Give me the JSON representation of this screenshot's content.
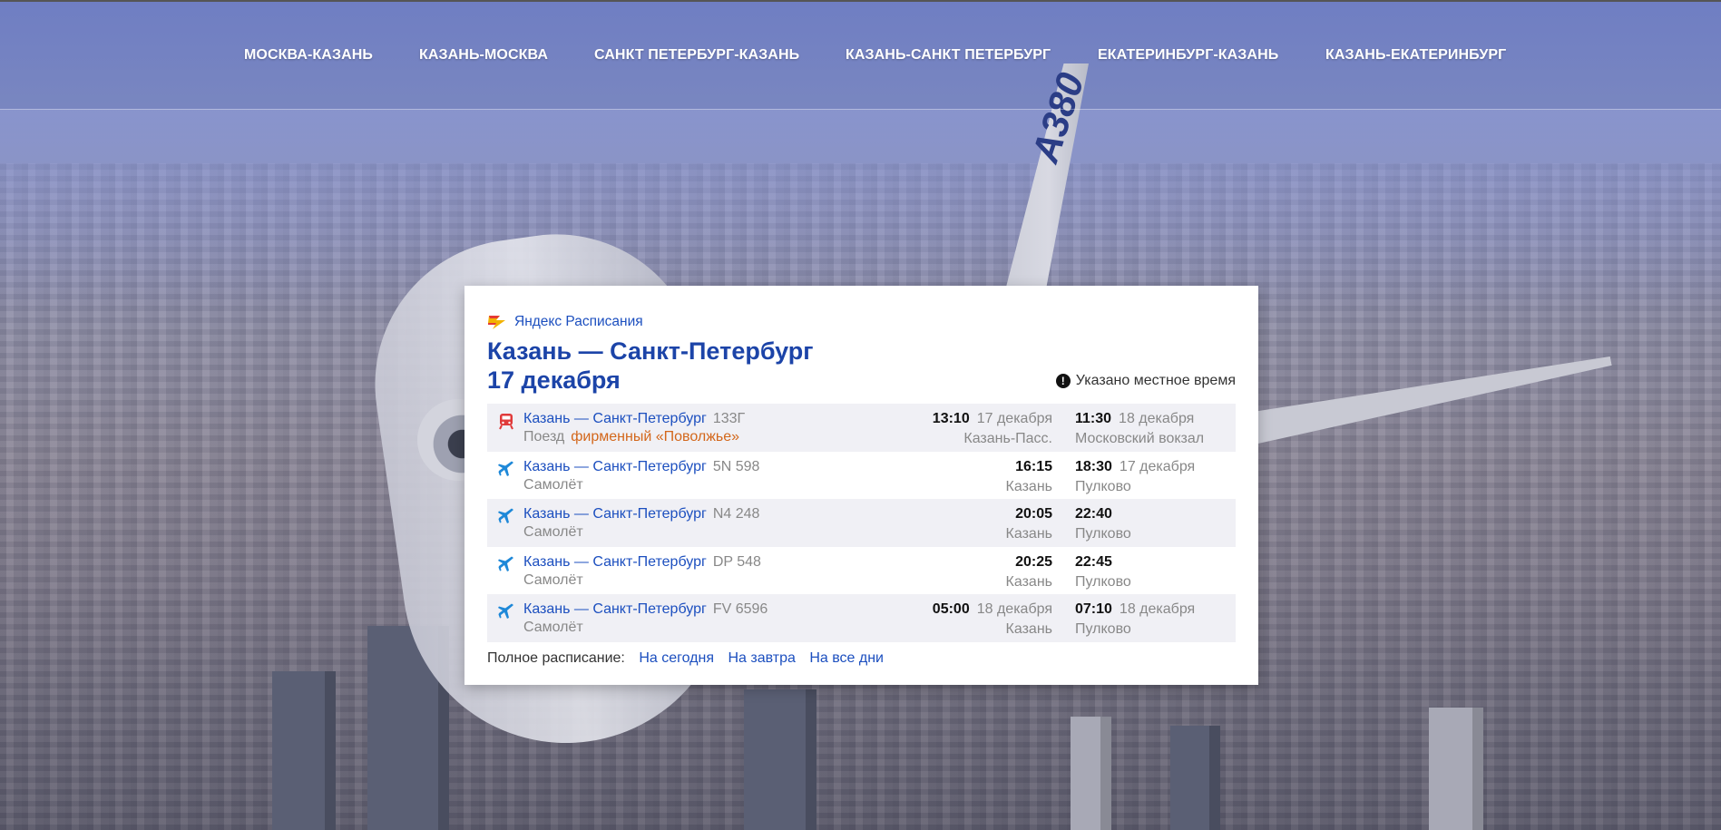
{
  "nav": {
    "links": [
      "МОСКВА-КАЗАНЬ",
      "КАЗАНЬ-МОСКВА",
      "САНКТ ПЕТЕРБУРГ-КАЗАНЬ",
      "КАЗАНЬ-САНКТ ПЕТЕРБУРГ",
      "ЕКАТЕРИНБУРГ-КАЗАНЬ",
      "КАЗАНЬ-ЕКАТЕРИНБУРГ"
    ]
  },
  "background": {
    "fin_text": "A380"
  },
  "widget": {
    "brand": "Яндекс Расписания",
    "title": "Казань — Санкт-Петербург",
    "date": "17 декабря",
    "note": "Указано местное время",
    "rows": [
      {
        "icon": "train-icon",
        "route": "Казань  — Санкт-Петербург",
        "number": "133Г",
        "kind": "Поезд",
        "brand_name": "фирменный «Поволжье»",
        "dep_time": "13:10",
        "dep_date": "17 декабря",
        "dep_station": "Казань-Пасс.",
        "arr_time": "11:30",
        "arr_date": "18 декабря",
        "arr_station": "Московский вокзал"
      },
      {
        "icon": "plane-icon",
        "route": "Казань  — Санкт-Петербург",
        "number": "5N 598",
        "kind": "Самолёт",
        "dep_time": "16:15",
        "dep_date": "",
        "dep_station": "Казань",
        "arr_time": "18:30",
        "arr_date": "17 декабря",
        "arr_station": "Пулково"
      },
      {
        "icon": "plane-icon",
        "route": "Казань  — Санкт-Петербург",
        "number": "N4 248",
        "kind": "Самолёт",
        "dep_time": "20:05",
        "dep_date": "",
        "dep_station": "Казань",
        "arr_time": "22:40",
        "arr_date": "",
        "arr_station": "Пулково"
      },
      {
        "icon": "plane-icon",
        "route": "Казань  — Санкт-Петербург",
        "number": "DP 548",
        "kind": "Самолёт",
        "dep_time": "20:25",
        "dep_date": "",
        "dep_station": "Казань",
        "arr_time": "22:45",
        "arr_date": "",
        "arr_station": "Пулково"
      },
      {
        "icon": "plane-icon",
        "route": "Казань  — Санкт-Петербург",
        "number": "FV 6596",
        "kind": "Самолёт",
        "dep_time": "05:00",
        "dep_date": "18 декабря",
        "dep_station": "Казань",
        "arr_time": "07:10",
        "arr_date": "18 декабря",
        "arr_station": "Пулково"
      }
    ],
    "footer": {
      "label": "Полное расписание:",
      "today": "На сегодня",
      "tomorrow": "На завтра",
      "all_days": "На все дни"
    }
  },
  "colors": {
    "link": "#1c4fbf",
    "title": "#1c44a8",
    "brand_name": "#d3671b",
    "train_icon": "#e03a3a",
    "plane_icon": "#1e88d8"
  }
}
